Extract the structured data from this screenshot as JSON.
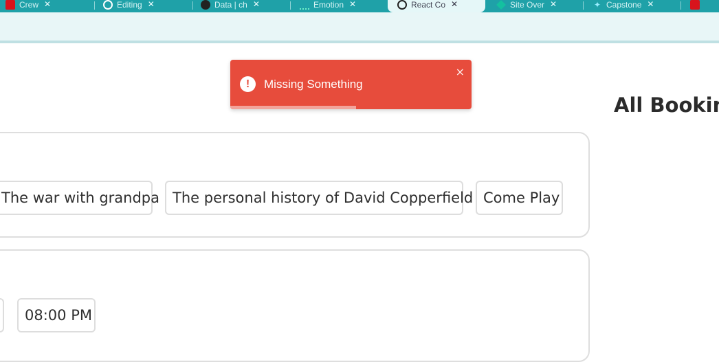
{
  "browser": {
    "tabs": [
      {
        "title": "Crew",
        "icon": "app-icon",
        "close": "✕"
      },
      {
        "title": "Editing",
        "icon": "half-circle-icon",
        "close": "✕"
      },
      {
        "title": "Data | ch",
        "icon": "circle-icon",
        "close": "✕"
      },
      {
        "title": "Emotion",
        "icon": "dots-icon",
        "close": "✕"
      },
      {
        "title": "React Co",
        "icon": "react-icon",
        "close": "✕"
      },
      {
        "title": "Site Over",
        "icon": "diamond-icon",
        "close": "✕"
      },
      {
        "title": "Capstone",
        "icon": "sparkle-icon",
        "close": "✕"
      }
    ]
  },
  "toast": {
    "message": "Missing Something",
    "icon": "exclamation-icon",
    "close": "×",
    "progress_percent": 52
  },
  "sidebar": {
    "heading": "All Bookings"
  },
  "movies": [
    "The war with grandpa",
    "The personal history of David Copperfield",
    "Come Play"
  ],
  "times": [
    "08:00 PM"
  ]
}
